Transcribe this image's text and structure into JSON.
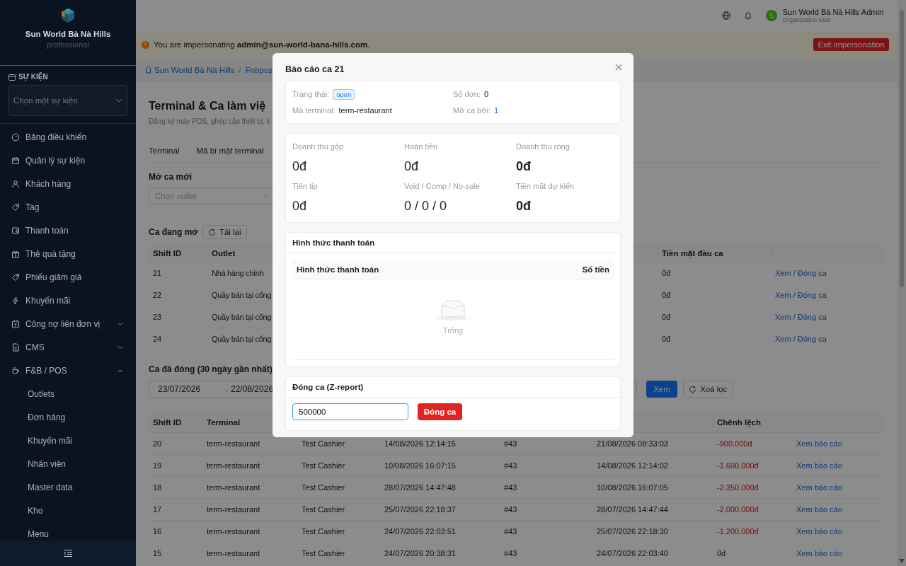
{
  "sidebar": {
    "brand": "Sun World Bà Nà Hills",
    "plan": "professional",
    "event_section": {
      "label": "SỰ KIỆN",
      "placeholder": "Chọn một sự kiện"
    },
    "items": [
      {
        "label": "Bảng điều khiển",
        "kind": "link"
      },
      {
        "label": "Quản lý sự kiện",
        "kind": "link"
      },
      {
        "label": "Khách hàng",
        "kind": "link"
      },
      {
        "label": "Tag",
        "kind": "link"
      },
      {
        "label": "Thanh toán",
        "kind": "link"
      },
      {
        "label": "Thẻ quà tặng",
        "kind": "link"
      },
      {
        "label": "Phiếu giảm giá",
        "kind": "link"
      },
      {
        "label": "Khuyến mãi",
        "kind": "link"
      },
      {
        "label": "Công nợ liên đơn vị",
        "kind": "group",
        "expanded": false
      },
      {
        "label": "CMS",
        "kind": "group",
        "expanded": false
      },
      {
        "label": "F&B / POS",
        "kind": "group",
        "expanded": true,
        "children": [
          {
            "label": "Outlets"
          },
          {
            "label": "Đơn hàng"
          },
          {
            "label": "Khuyến mãi"
          },
          {
            "label": "Nhân viên"
          },
          {
            "label": "Master data"
          },
          {
            "label": "Kho"
          },
          {
            "label": "Menu"
          }
        ]
      }
    ]
  },
  "header": {
    "user": {
      "initial": "S",
      "name": "Sun World Bà Nà Hills Admin",
      "role": "Organization User"
    }
  },
  "banner": {
    "text": "You are impersonating **admin@sun-world-bana-hills.com**.",
    "button": "Exit impersonation"
  },
  "breadcrumb": {
    "separator": "/",
    "items": [
      "Sun World Bà Nà Hills",
      "Fnbpos"
    ]
  },
  "page": {
    "title": "Terminal & Ca làm việ",
    "subtitle": "Đăng ký máy POS, ghép cặp thiết bị, k",
    "tabs": [
      {
        "label": "Terminal",
        "selected": false
      },
      {
        "label": "Mã bí mật terminal",
        "selected": false
      }
    ],
    "open_form": {
      "label": "Mở ca mới",
      "placeholder": "Chọn outlet"
    },
    "open_shifts": {
      "title": "Ca đang mở",
      "reload": "Tải lại",
      "columns": [
        "Shift ID",
        "Outlet",
        "Tiền mặt đầu ca"
      ],
      "rows": [
        {
          "shift_id": "21",
          "outlet": "Nhà hàng chính",
          "opening_cash": "0đ",
          "action": "Xem / Đóng ca"
        },
        {
          "shift_id": "22",
          "outlet": "Quầy bán tại cổng",
          "opening_cash": "0đ",
          "action": "Xem / Đóng ca"
        },
        {
          "shift_id": "23",
          "outlet": "Quầy bán tại cổng",
          "opening_cash": "0đ",
          "action": "Xem / Đóng ca"
        },
        {
          "shift_id": "24",
          "outlet": "Quầy bán tại cổng",
          "opening_cash": "0đ",
          "action": "Xem / Đóng ca"
        }
      ]
    },
    "closed_shifts": {
      "title": "Ca đã đóng (30 ngày gần nhất)",
      "date_from": "23/07/2026",
      "range_separator": "→",
      "date_to": "22/08/2026",
      "view_button": "Xem",
      "clear_button": "Xoá lọc",
      "columns": [
        "Shift ID",
        "Terminal",
        "Chênh lệch"
      ],
      "rows": [
        {
          "shift_id": "20",
          "terminal": "term-restaurant",
          "column_3": "Test Cashier",
          "column_4": "14/08/2026 12:14:15",
          "column_5": "#43",
          "column_6": "21/08/2026 08:33:03",
          "difference": "-900.000đ",
          "negative": true,
          "action": "Xem báo cáo"
        },
        {
          "shift_id": "19",
          "terminal": "term-restaurant",
          "column_3": "Test Cashier",
          "column_4": "10/08/2026 16:07:15",
          "column_5": "#43",
          "column_6": "14/08/2026 12:14:02",
          "difference": "-1.600.000đ",
          "negative": true,
          "action": "Xem báo cáo"
        },
        {
          "shift_id": "18",
          "terminal": "term-restaurant",
          "column_3": "Test Cashier",
          "column_4": "28/07/2026 14:47:48",
          "column_5": "#43",
          "column_6": "10/08/2026 16:07:05",
          "difference": "-2.350.000đ",
          "negative": true,
          "action": "Xem báo cáo"
        },
        {
          "shift_id": "17",
          "terminal": "term-restaurant",
          "column_3": "Test Cashier",
          "column_4": "25/07/2026 22:18:37",
          "column_5": "#43",
          "column_6": "28/07/2026 14:47:44",
          "difference": "-2.000.000đ",
          "negative": true,
          "action": "Xem báo cáo"
        },
        {
          "shift_id": "16",
          "terminal": "term-restaurant",
          "column_3": "Test Cashier",
          "column_4": "24/07/2026 22:03:51",
          "column_5": "#43",
          "column_6": "25/07/2026 22:18:30",
          "difference": "-1.200.000đ",
          "negative": true,
          "action": "Xem báo cáo"
        },
        {
          "shift_id": "15",
          "terminal": "term-restaurant",
          "column_3": "Test Cashier",
          "column_4": "24/07/2026 20:38:31",
          "column_5": "#43",
          "column_6": "24/07/2026 22:03:40",
          "difference": "0đ",
          "negative": false,
          "action": "Xem báo cáo"
        }
      ]
    }
  },
  "modal": {
    "title": "Báo cáo ca 21",
    "info": [
      {
        "label": "Trạng thái:",
        "value": "open",
        "kind": "tag"
      },
      {
        "label": "Số đơn:",
        "value": "0",
        "kind": "text"
      },
      {
        "label": "Mã terminal:",
        "value": "term-restaurant",
        "kind": "text"
      },
      {
        "label": "Mở ca bởi:",
        "value": "1",
        "kind": "link"
      }
    ],
    "stats": [
      {
        "label": "Doanh thu gộp",
        "value": "0đ",
        "emphasis": false
      },
      {
        "label": "Hoàn tiền",
        "value": "0đ",
        "emphasis": false
      },
      {
        "label": "Doanh thu ròng",
        "value": "0đ",
        "emphasis": true
      },
      {
        "label": "Tiền tip",
        "value": "0đ",
        "emphasis": false
      },
      {
        "label": "Void / Comp / No-sale",
        "value": "0 / 0 / 0",
        "emphasis": false
      },
      {
        "label": "Tiền mặt dự kiến",
        "value": "0đ",
        "emphasis": true
      }
    ],
    "payments": {
      "title": "Hình thức thanh toán",
      "columns": [
        "Hình thức thanh toán",
        "Số tiền"
      ],
      "empty": "Trống"
    },
    "close_shift": {
      "title": "Đóng ca (Z-report)",
      "value": "500000",
      "button": "Đóng ca"
    }
  }
}
